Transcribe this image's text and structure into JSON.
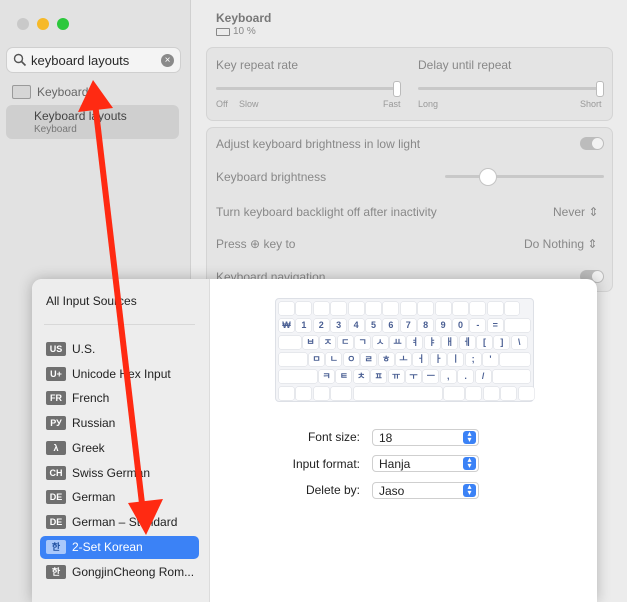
{
  "sidebar": {
    "search_value": "keyboard layouts",
    "keyboard_label": "Keyboard",
    "result_title": "Keyboard layouts",
    "result_sub": "Keyboard"
  },
  "main": {
    "title": "Keyboard",
    "battery": "10 %",
    "repeat_rate": "Key repeat rate",
    "delay": "Delay until repeat",
    "rate_off": "Off",
    "rate_slow": "Slow",
    "rate_fast": "Fast",
    "delay_long": "Long",
    "delay_short": "Short",
    "adjust_brightness": "Adjust keyboard brightness in low light",
    "kb_brightness": "Keyboard brightness",
    "backlight_off": "Turn keyboard backlight off after inactivity",
    "backlight_value": "Never",
    "press_key": "Press",
    "press_key_suffix": "key to",
    "press_value": "Do Nothing",
    "kb_navigation": "Keyboard navigation"
  },
  "panel": {
    "all_sources": "All Input Sources",
    "items": [
      {
        "badge": "US",
        "name": "U.S."
      },
      {
        "badge": "U+",
        "name": "Unicode Hex Input"
      },
      {
        "badge": "FR",
        "name": "French"
      },
      {
        "badge": "РУ",
        "name": "Russian"
      },
      {
        "badge": "λ",
        "name": "Greek"
      },
      {
        "badge": "CH",
        "name": "Swiss German"
      },
      {
        "badge": "DE",
        "name": "German"
      },
      {
        "badge": "DE",
        "name": "German – Standard"
      },
      {
        "badge": "한",
        "name": "2-Set Korean"
      },
      {
        "badge": "한",
        "name": "GongjinCheong Rom..."
      }
    ],
    "font_size_label": "Font size:",
    "font_size_value": "18",
    "input_format_label": "Input format:",
    "input_format_value": "Hanja",
    "delete_by_label": "Delete by:",
    "delete_by_value": "Jaso",
    "keyboard_rows": [
      [
        "₩",
        "1",
        "2",
        "3",
        "4",
        "5",
        "6",
        "7",
        "8",
        "9",
        "0",
        "-",
        "="
      ],
      [
        "ㅂ",
        "ㅈ",
        "ㄷ",
        "ㄱ",
        "ㅅ",
        "ㅛ",
        "ㅕ",
        "ㅑ",
        "ㅐ",
        "ㅔ",
        "[",
        "]",
        "\\"
      ],
      [
        "ㅁ",
        "ㄴ",
        "ㅇ",
        "ㄹ",
        "ㅎ",
        "ㅗ",
        "ㅓ",
        "ㅏ",
        "ㅣ",
        ";",
        "'"
      ],
      [
        "ㅋ",
        "ㅌ",
        "ㅊ",
        "ㅍ",
        "ㅠ",
        "ㅜ",
        "ㅡ",
        ",",
        ".",
        "/"
      ]
    ]
  },
  "colors": {
    "accent": "#3b82f6",
    "arrow": "#ff2a12"
  }
}
